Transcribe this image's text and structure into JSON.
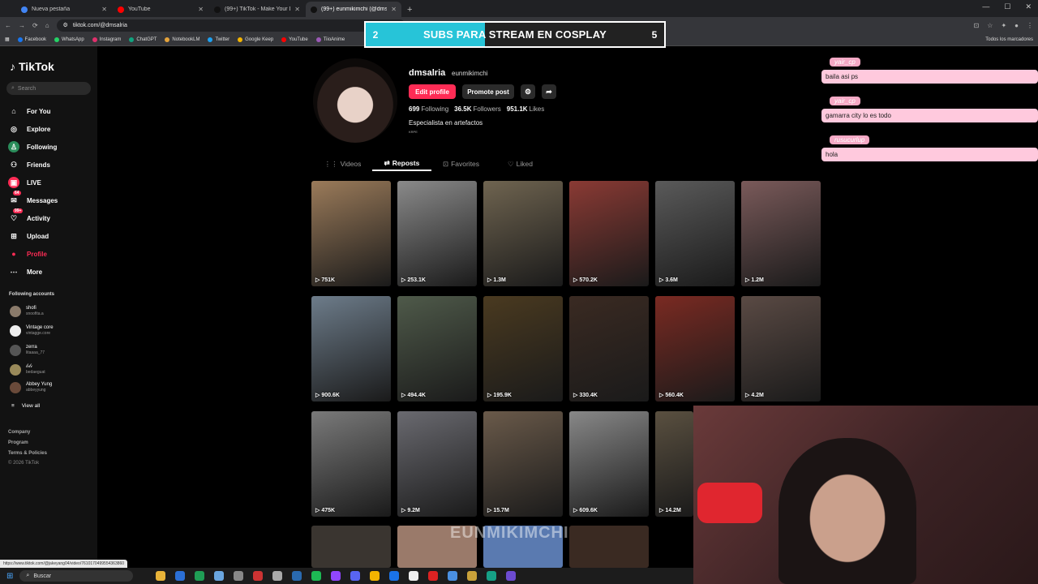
{
  "browser": {
    "tabs": [
      {
        "label": "Nueva pestaña",
        "color": "#4285f4",
        "active": false
      },
      {
        "label": "YouTube",
        "color": "#ff0000",
        "active": false
      },
      {
        "label": "(99+) TikTok - Make Your Day",
        "color": "#111111",
        "active": false
      },
      {
        "label": "(99+) eunmikimchi (@dmsalria)",
        "color": "#111111",
        "active": true
      }
    ],
    "url": "tiktok.com/@dmsalria",
    "bookmarks": [
      "Facebook",
      "WhatsApp",
      "Instagram",
      "ChatGPT",
      "NotebookLM",
      "Twitter",
      "Google Keep",
      "YouTube",
      "TiioAnime"
    ],
    "bookmarks_right": "Todos los marcadores"
  },
  "banner": {
    "left": "2",
    "text": "SUBS PARA STREAM EN COSPLAY",
    "right": "5",
    "progress": 0.4
  },
  "sidebar": {
    "logo": "TikTok",
    "search_placeholder": "Search",
    "nav": [
      {
        "label": "For You",
        "icon": "home-icon",
        "glyph": "⌂"
      },
      {
        "label": "Explore",
        "icon": "compass-icon",
        "glyph": "◎"
      },
      {
        "label": "Following",
        "icon": "following-icon",
        "glyph": "♙"
      },
      {
        "label": "Friends",
        "icon": "friends-icon",
        "glyph": "⚇"
      },
      {
        "label": "LIVE",
        "icon": "live-icon",
        "glyph": "▣"
      },
      {
        "label": "Messages",
        "icon": "messages-icon",
        "glyph": "✉",
        "badge": "64"
      },
      {
        "label": "Activity",
        "icon": "activity-icon",
        "glyph": "♡",
        "badge": "99+"
      },
      {
        "label": "Upload",
        "icon": "upload-icon",
        "glyph": "⊞"
      },
      {
        "label": "Profile",
        "icon": "profile-icon",
        "glyph": "●"
      },
      {
        "label": "More",
        "icon": "more-icon",
        "glyph": "⋯"
      }
    ],
    "following_header": "Following accounts",
    "accounts": [
      {
        "name": "shofi",
        "handle": "snoofita.a"
      },
      {
        "name": "Vintage core",
        "handle": "vintagge.core"
      },
      {
        "name": "zerra",
        "handle": "litaaaa_77"
      },
      {
        "name": "𝓁𝒾𝓁𝒾",
        "handle": "bedaeguat"
      },
      {
        "name": "Abbey Yung",
        "handle": "abbeyyung"
      }
    ],
    "view_all": "View all",
    "footer": [
      "Company",
      "Program",
      "Terms & Policies",
      "© 2026 TikTok"
    ]
  },
  "profile": {
    "username": "dmsalria",
    "nickname": "eunmikimchi",
    "edit_label": "Edit profile",
    "promote_label": "Promote post",
    "following_count": "699",
    "following_label": "Following",
    "followers_count": "36.5K",
    "followers_label": "Followers",
    "likes_count": "951.1K",
    "likes_label": "Likes",
    "bio": "Especialista en artefactos",
    "bio_small": "KRPE",
    "tabs": [
      "Videos",
      "Reposts",
      "Favorites",
      "Liked"
    ]
  },
  "grid": [
    {
      "views": "751K",
      "color": "#9b7b5a"
    },
    {
      "views": "253.1K",
      "color": "#8a8a8a"
    },
    {
      "views": "1.3M",
      "color": "#6f6450"
    },
    {
      "views": "570.2K",
      "color": "#8a3a34"
    },
    {
      "views": "3.6M",
      "color": "#5a5a5a"
    },
    {
      "views": "1.2M",
      "color": "#7a5a5a"
    },
    {
      "views": "900.6K",
      "color": "#6d7c8a"
    },
    {
      "views": "494.4K",
      "color": "#4f5a4a"
    },
    {
      "views": "195.9K",
      "color": "#4a3a20"
    },
    {
      "views": "330.4K",
      "color": "#3a2a22"
    },
    {
      "views": "560.4K",
      "color": "#7a2a22"
    },
    {
      "views": "4.2M",
      "color": "#5a4a44"
    },
    {
      "views": "475K",
      "color": "#7a7a7a"
    },
    {
      "views": "9.2M",
      "color": "#6a6a70"
    },
    {
      "views": "15.7M",
      "color": "#6a5a4a"
    },
    {
      "views": "609.6K",
      "color": "#888888"
    },
    {
      "views": "14.2M",
      "color": "#5a5040"
    }
  ],
  "chat": [
    {
      "user": "yair_cp",
      "message": "baila asi ps"
    },
    {
      "user": "yair_cp",
      "message": "gamarra city lo es todo"
    },
    {
      "user": "rusucurlup",
      "message": "hola"
    }
  ],
  "overlay": {
    "watermark": "EUNMIKIMCHI"
  },
  "status_url": "https://www.tiktok.com/@jakeyang04/video/7610170499554363860",
  "taskbar": {
    "search_label": "Buscar"
  }
}
